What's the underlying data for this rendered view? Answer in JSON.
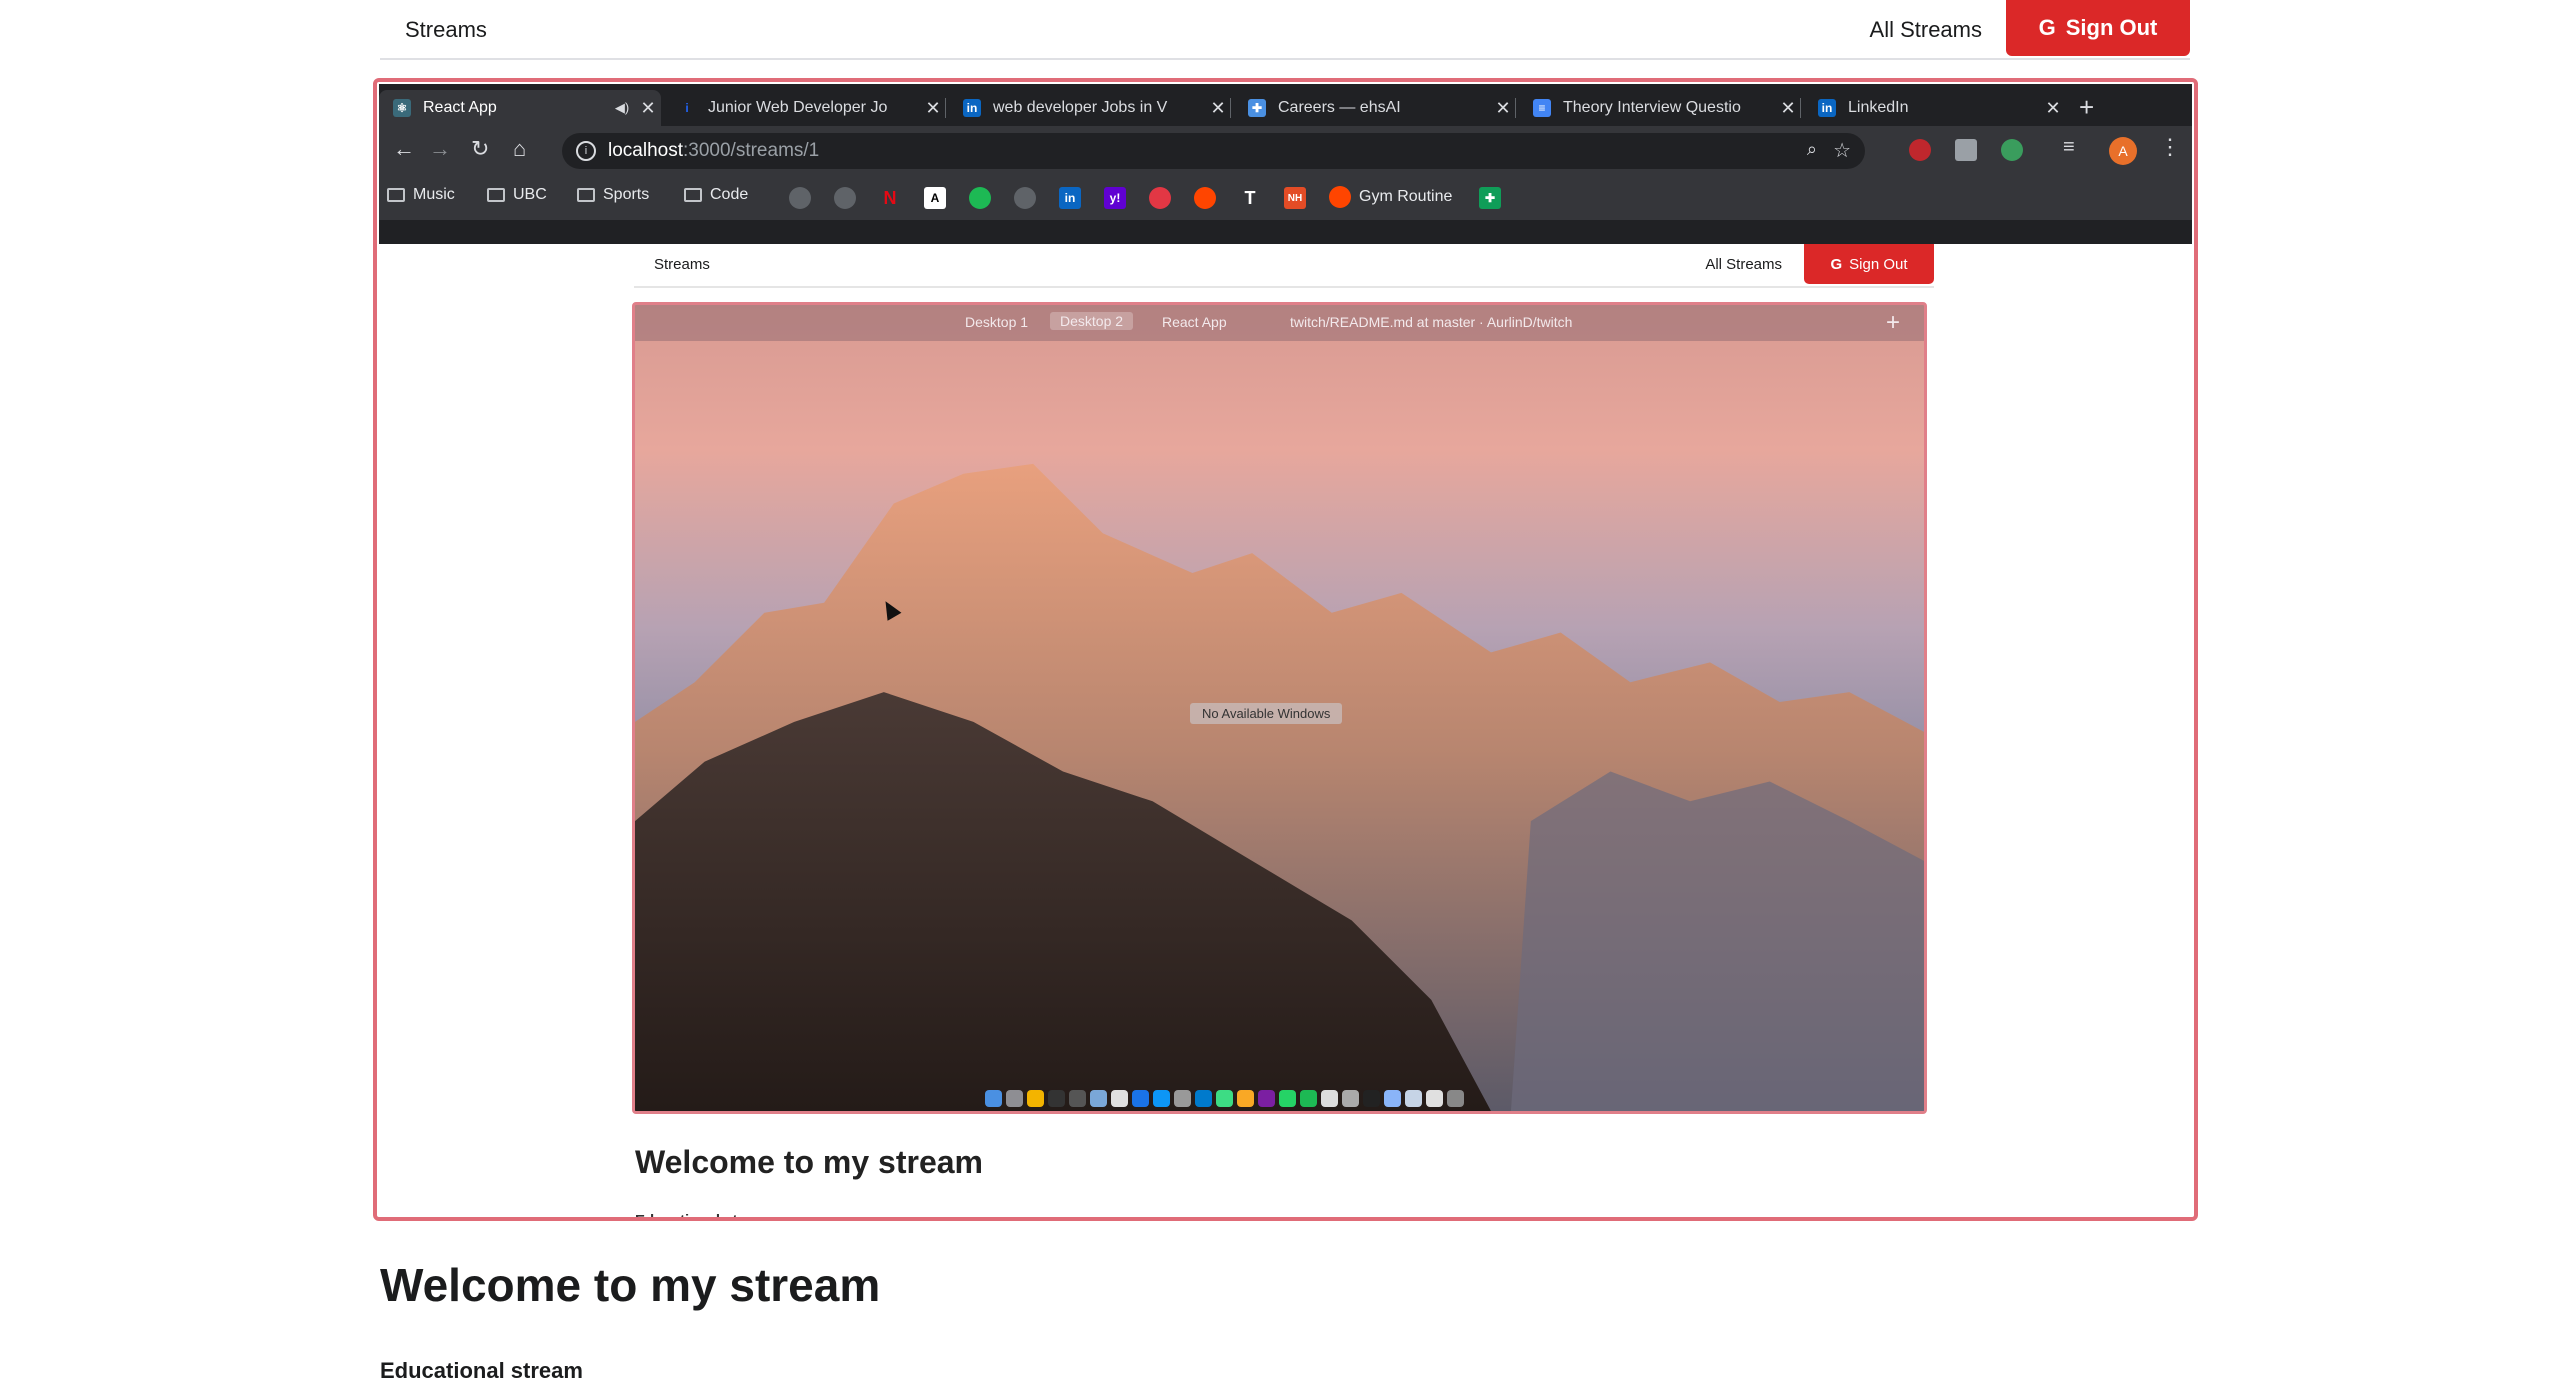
{
  "menu": {
    "brand": "Streams",
    "all_streams": "All Streams",
    "sign_out": "Sign Out",
    "google_glyph": "G"
  },
  "browser": {
    "tabs": [
      {
        "title": "React App",
        "favicon": "react-icon",
        "color": "#61dafb"
      },
      {
        "title": "Junior Web Developer Jo",
        "favicon": "indeed-icon",
        "color": "#2164f3"
      },
      {
        "title": "web developer Jobs in V",
        "favicon": "linkedin-icon",
        "color": "#0a66c2"
      },
      {
        "title": "Careers — ehsAI",
        "favicon": "puzzle-icon",
        "color": "#4a90e2"
      },
      {
        "title": "Theory Interview Questio",
        "favicon": "docs-icon",
        "color": "#4285f4"
      },
      {
        "title": "LinkedIn",
        "favicon": "linkedin-icon",
        "color": "#0a66c2"
      }
    ],
    "url_host": "localhost",
    "url_path": ":3000/streams/1",
    "avatar_letter": "A",
    "bookmarks": [
      "Music",
      "UBC",
      "Sports",
      "Code",
      "Gym Routine"
    ]
  },
  "inner": {
    "brand": "Streams",
    "all_streams": "All Streams",
    "sign_out": "Sign Out",
    "video_tabs": [
      "Desktop 1",
      "Desktop 2",
      "React App",
      "twitch/README.md at master · AurlinD/twitch"
    ],
    "no_windows": "No Available Windows",
    "heading": "Welcome to my stream",
    "subheading": "Educational stream"
  },
  "stream": {
    "title": "Welcome to my stream",
    "description": "Educational stream"
  },
  "colors": {
    "accent_red": "#db2828",
    "frame_border": "#e06c78"
  }
}
